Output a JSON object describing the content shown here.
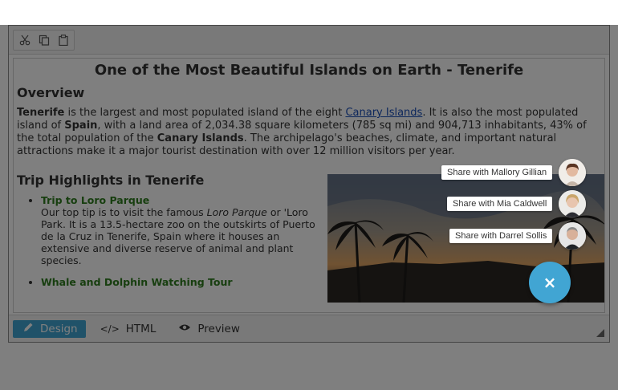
{
  "document": {
    "title": "One of the Most Beautiful Islands on Earth - Tenerife",
    "overview_heading": "Overview",
    "overview": {
      "p1_bold": "Tenerife",
      "p1_a": " is the largest and most populated island of the eight ",
      "link": "Canary Islands",
      "p1_b": ". It is also the most populated island of ",
      "p1_bold2": "Spain",
      "p1_c": ", with a land area of 2,034.38 square kilometers (785 sq mi) and 904,713 inhabitants, 43% of the total population of the ",
      "p1_bold3": "Canary Islands",
      "p1_d": ". The archipelago's beaches, climate, and important natural attractions make it a major tourist destination with over 12 million visitors per year."
    },
    "highlights_heading": "Trip Highlights in Tenerife",
    "highlights": [
      {
        "title": "Trip to Loro Parque",
        "text_a": "Our top tip is to visit the famous ",
        "italic": "Loro Parque",
        "text_b": " or 'Loro Park. It is a 13.5-hectare zoo on the outskirts of Puerto de la Cruz in Tenerife, Spain where it houses an extensive and diverse reserve of animal and plant species."
      },
      {
        "title": "Whale and Dolphin Watching Tour"
      }
    ]
  },
  "modes": {
    "design": "Design",
    "html": "HTML",
    "preview": "Preview"
  },
  "share": {
    "items": [
      {
        "label": "Share with Mallory Gillian"
      },
      {
        "label": "Share with Mia Caldwell"
      },
      {
        "label": "Share with Darrel Sollis"
      }
    ],
    "close_symbol": "×"
  },
  "colors": {
    "accent": "#41a5d3",
    "highlight_title": "#2e7d1e",
    "link": "#1a4fb8"
  }
}
